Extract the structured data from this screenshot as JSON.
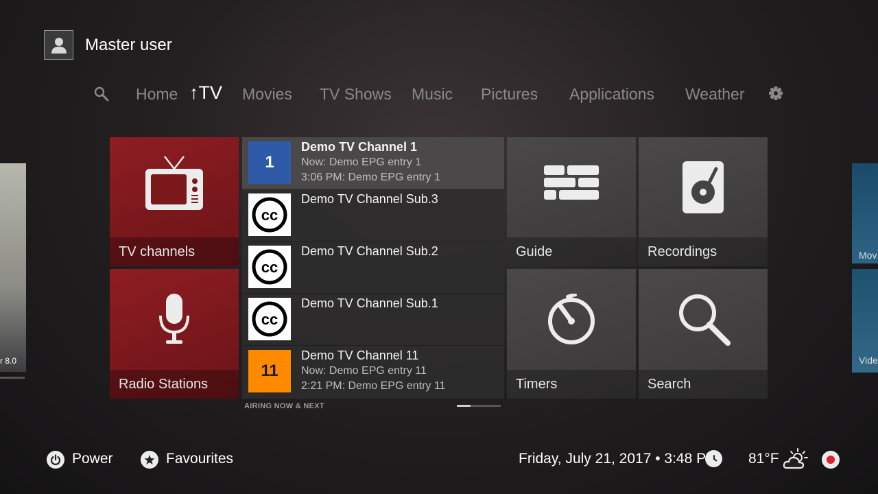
{
  "header": {
    "user_name": "Master user",
    "avatar_icon": "user-silhouette-icon"
  },
  "nav": {
    "search_icon": "search-icon",
    "items": [
      "Home",
      "TV",
      "Movies",
      "TV Shows",
      "Music",
      "Pictures",
      "Applications",
      "Weather"
    ],
    "active": "TV",
    "settings_icon": "gear-icon"
  },
  "side_peeks": {
    "left_label": "r 8.0",
    "right_top_label": "Mov",
    "right_bottom_label": "Vide"
  },
  "tiles": {
    "tv_channels": "TV channels",
    "radio_stations": "Radio Stations",
    "guide": "Guide",
    "recordings": "Recordings",
    "timers": "Timers",
    "search": "Search"
  },
  "channels": [
    {
      "logo": "1",
      "name": "Demo TV Channel 1",
      "now": "Now: Demo EPG entry 1",
      "next": "3:06 PM: Demo EPG entry 1"
    },
    {
      "logo": "cc",
      "name": "Demo TV Channel Sub.3",
      "now": "",
      "next": ""
    },
    {
      "logo": "cc",
      "name": "Demo TV Channel Sub.2",
      "now": "",
      "next": ""
    },
    {
      "logo": "cc",
      "name": "Demo TV Channel Sub.1",
      "now": "",
      "next": ""
    },
    {
      "logo": "11",
      "name": "Demo TV Channel 11",
      "now": "Now: Demo EPG entry 11",
      "next": "2:21 PM: Demo EPG entry 11"
    }
  ],
  "list_caption": "AIRING NOW & NEXT",
  "footer": {
    "power": "Power",
    "favourites": "Favourites",
    "datetime": "Friday, July 21, 2017 • 3:48 PM",
    "temperature": "81°F"
  },
  "colors": {
    "accent_red": "#8e1d22",
    "channel1_logo": "#2f5aa8",
    "channel11_logo": "#ff8a00",
    "record_dot": "#e0202a"
  }
}
